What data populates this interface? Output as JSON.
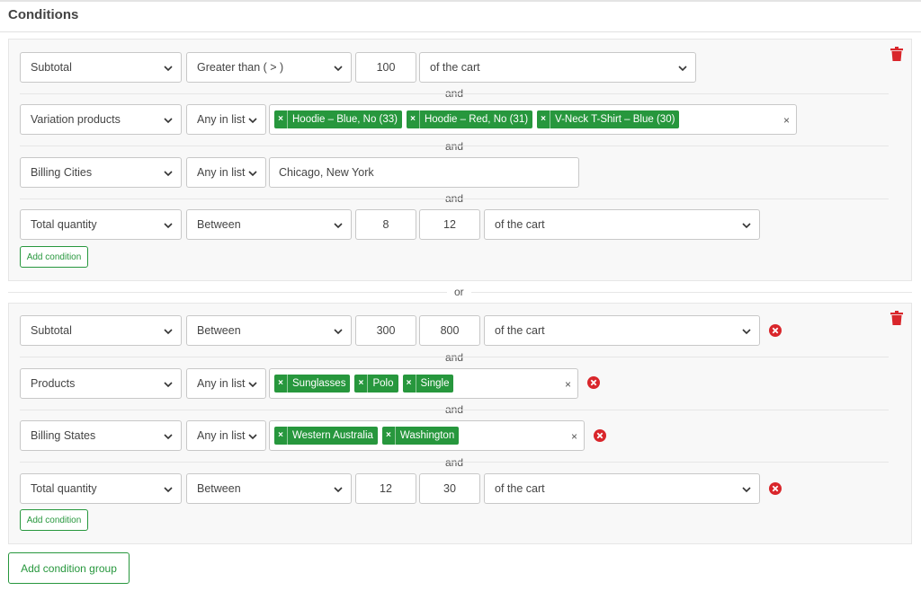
{
  "title": "Conditions",
  "colors": {
    "accent": "#27973d",
    "danger": "#d9262b"
  },
  "connectors": {
    "and": "and",
    "or": "or"
  },
  "add_condition_label": "Add condition",
  "add_group_label": "Add condition group",
  "group1": {
    "r1": {
      "field": "Subtotal",
      "op": "Greater than ( > )",
      "value": "100",
      "scope": "of the cart"
    },
    "r2": {
      "field": "Variation products",
      "op": "Any in list",
      "chips": [
        "Hoodie – Blue, No (33)",
        "Hoodie – Red, No (31)",
        "V-Neck T-Shirt – Blue (30)"
      ],
      "clear": "×"
    },
    "r3": {
      "field": "Billing Cities",
      "op": "Any in list",
      "value": "Chicago, New York"
    },
    "r4": {
      "field": "Total quantity",
      "op": "Between",
      "min": "8",
      "max": "12",
      "scope": "of the cart"
    }
  },
  "group2": {
    "r1": {
      "field": "Subtotal",
      "op": "Between",
      "min": "300",
      "max": "800",
      "scope": "of the cart"
    },
    "r2": {
      "field": "Products",
      "op": "Any in list",
      "chips": [
        "Sunglasses",
        "Polo",
        "Single"
      ],
      "clear": "×"
    },
    "r3": {
      "field": "Billing States",
      "op": "Any in list",
      "chips": [
        "Western Australia",
        "Washington"
      ],
      "clear": "×"
    },
    "r4": {
      "field": "Total quantity",
      "op": "Between",
      "min": "12",
      "max": "30",
      "scope": "of the cart"
    }
  },
  "chip_remove": "×"
}
